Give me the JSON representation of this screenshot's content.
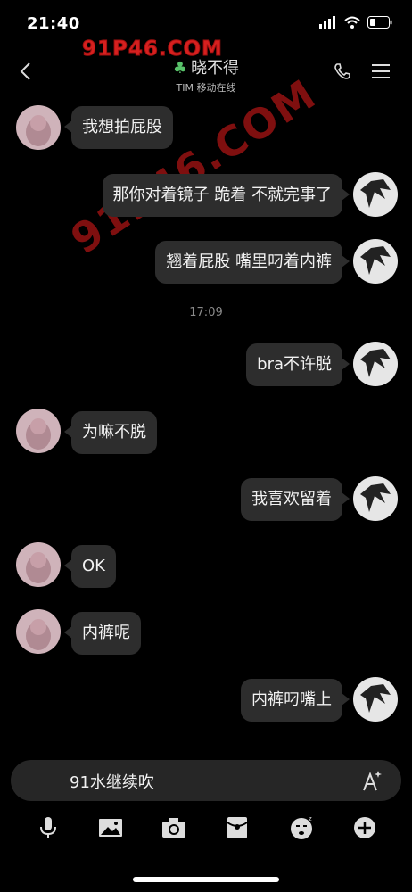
{
  "status_bar": {
    "time": "21:40"
  },
  "watermark": {
    "top_text": "91P46.COM",
    "diagonal_text": "91P46.COM"
  },
  "header": {
    "title": "晓不得",
    "subtitle": "TIM 移动在线"
  },
  "messages": [
    {
      "side": "left",
      "text": "我想拍屁股"
    },
    {
      "side": "right",
      "text": "那你对着镜子 跪着 不就完事了"
    },
    {
      "side": "right",
      "text": "翘着屁股 嘴里叼着内裤"
    },
    {
      "side": "right",
      "text": "bra不许脱"
    },
    {
      "side": "left",
      "text": "为嘛不脱"
    },
    {
      "side": "right",
      "text": "我喜欢留着"
    },
    {
      "side": "left",
      "text": "OK"
    },
    {
      "side": "left",
      "text": "内裤呢"
    },
    {
      "side": "right",
      "text": "内裤叼嘴上"
    }
  ],
  "timestamp": "17:09",
  "input": {
    "value": "91水继续吹"
  },
  "colors": {
    "background": "#000000",
    "bubble": "#2d2d2d",
    "watermark": "#d6201f",
    "leaf": "#58c26a"
  },
  "icons": {
    "back": "chevron-left-icon",
    "call": "phone-icon",
    "menu": "menu-icon",
    "font": "font-size-icon",
    "toolbar": [
      "microphone-icon",
      "image-icon",
      "camera-icon",
      "red-packet-icon",
      "emoji-icon",
      "plus-icon"
    ]
  }
}
